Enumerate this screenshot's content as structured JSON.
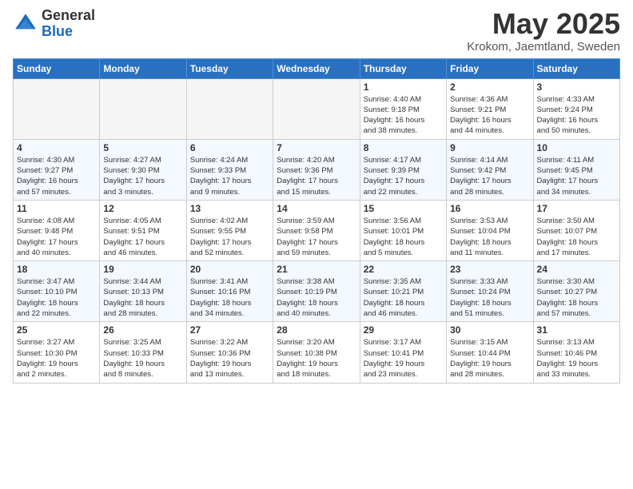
{
  "logo": {
    "general": "General",
    "blue": "Blue"
  },
  "title": {
    "month": "May 2025",
    "location": "Krokom, Jaemtland, Sweden"
  },
  "weekdays": [
    "Sunday",
    "Monday",
    "Tuesday",
    "Wednesday",
    "Thursday",
    "Friday",
    "Saturday"
  ],
  "weeks": [
    [
      {
        "day": "",
        "info": ""
      },
      {
        "day": "",
        "info": ""
      },
      {
        "day": "",
        "info": ""
      },
      {
        "day": "",
        "info": ""
      },
      {
        "day": "1",
        "info": "Sunrise: 4:40 AM\nSunset: 9:18 PM\nDaylight: 16 hours\nand 38 minutes."
      },
      {
        "day": "2",
        "info": "Sunrise: 4:36 AM\nSunset: 9:21 PM\nDaylight: 16 hours\nand 44 minutes."
      },
      {
        "day": "3",
        "info": "Sunrise: 4:33 AM\nSunset: 9:24 PM\nDaylight: 16 hours\nand 50 minutes."
      }
    ],
    [
      {
        "day": "4",
        "info": "Sunrise: 4:30 AM\nSunset: 9:27 PM\nDaylight: 16 hours\nand 57 minutes."
      },
      {
        "day": "5",
        "info": "Sunrise: 4:27 AM\nSunset: 9:30 PM\nDaylight: 17 hours\nand 3 minutes."
      },
      {
        "day": "6",
        "info": "Sunrise: 4:24 AM\nSunset: 9:33 PM\nDaylight: 17 hours\nand 9 minutes."
      },
      {
        "day": "7",
        "info": "Sunrise: 4:20 AM\nSunset: 9:36 PM\nDaylight: 17 hours\nand 15 minutes."
      },
      {
        "day": "8",
        "info": "Sunrise: 4:17 AM\nSunset: 9:39 PM\nDaylight: 17 hours\nand 22 minutes."
      },
      {
        "day": "9",
        "info": "Sunrise: 4:14 AM\nSunset: 9:42 PM\nDaylight: 17 hours\nand 28 minutes."
      },
      {
        "day": "10",
        "info": "Sunrise: 4:11 AM\nSunset: 9:45 PM\nDaylight: 17 hours\nand 34 minutes."
      }
    ],
    [
      {
        "day": "11",
        "info": "Sunrise: 4:08 AM\nSunset: 9:48 PM\nDaylight: 17 hours\nand 40 minutes."
      },
      {
        "day": "12",
        "info": "Sunrise: 4:05 AM\nSunset: 9:51 PM\nDaylight: 17 hours\nand 46 minutes."
      },
      {
        "day": "13",
        "info": "Sunrise: 4:02 AM\nSunset: 9:55 PM\nDaylight: 17 hours\nand 52 minutes."
      },
      {
        "day": "14",
        "info": "Sunrise: 3:59 AM\nSunset: 9:58 PM\nDaylight: 17 hours\nand 59 minutes."
      },
      {
        "day": "15",
        "info": "Sunrise: 3:56 AM\nSunset: 10:01 PM\nDaylight: 18 hours\nand 5 minutes."
      },
      {
        "day": "16",
        "info": "Sunrise: 3:53 AM\nSunset: 10:04 PM\nDaylight: 18 hours\nand 11 minutes."
      },
      {
        "day": "17",
        "info": "Sunrise: 3:50 AM\nSunset: 10:07 PM\nDaylight: 18 hours\nand 17 minutes."
      }
    ],
    [
      {
        "day": "18",
        "info": "Sunrise: 3:47 AM\nSunset: 10:10 PM\nDaylight: 18 hours\nand 22 minutes."
      },
      {
        "day": "19",
        "info": "Sunrise: 3:44 AM\nSunset: 10:13 PM\nDaylight: 18 hours\nand 28 minutes."
      },
      {
        "day": "20",
        "info": "Sunrise: 3:41 AM\nSunset: 10:16 PM\nDaylight: 18 hours\nand 34 minutes."
      },
      {
        "day": "21",
        "info": "Sunrise: 3:38 AM\nSunset: 10:19 PM\nDaylight: 18 hours\nand 40 minutes."
      },
      {
        "day": "22",
        "info": "Sunrise: 3:35 AM\nSunset: 10:21 PM\nDaylight: 18 hours\nand 46 minutes."
      },
      {
        "day": "23",
        "info": "Sunrise: 3:33 AM\nSunset: 10:24 PM\nDaylight: 18 hours\nand 51 minutes."
      },
      {
        "day": "24",
        "info": "Sunrise: 3:30 AM\nSunset: 10:27 PM\nDaylight: 18 hours\nand 57 minutes."
      }
    ],
    [
      {
        "day": "25",
        "info": "Sunrise: 3:27 AM\nSunset: 10:30 PM\nDaylight: 19 hours\nand 2 minutes."
      },
      {
        "day": "26",
        "info": "Sunrise: 3:25 AM\nSunset: 10:33 PM\nDaylight: 19 hours\nand 8 minutes."
      },
      {
        "day": "27",
        "info": "Sunrise: 3:22 AM\nSunset: 10:36 PM\nDaylight: 19 hours\nand 13 minutes."
      },
      {
        "day": "28",
        "info": "Sunrise: 3:20 AM\nSunset: 10:38 PM\nDaylight: 19 hours\nand 18 minutes."
      },
      {
        "day": "29",
        "info": "Sunrise: 3:17 AM\nSunset: 10:41 PM\nDaylight: 19 hours\nand 23 minutes."
      },
      {
        "day": "30",
        "info": "Sunrise: 3:15 AM\nSunset: 10:44 PM\nDaylight: 19 hours\nand 28 minutes."
      },
      {
        "day": "31",
        "info": "Sunrise: 3:13 AM\nSunset: 10:46 PM\nDaylight: 19 hours\nand 33 minutes."
      }
    ]
  ]
}
